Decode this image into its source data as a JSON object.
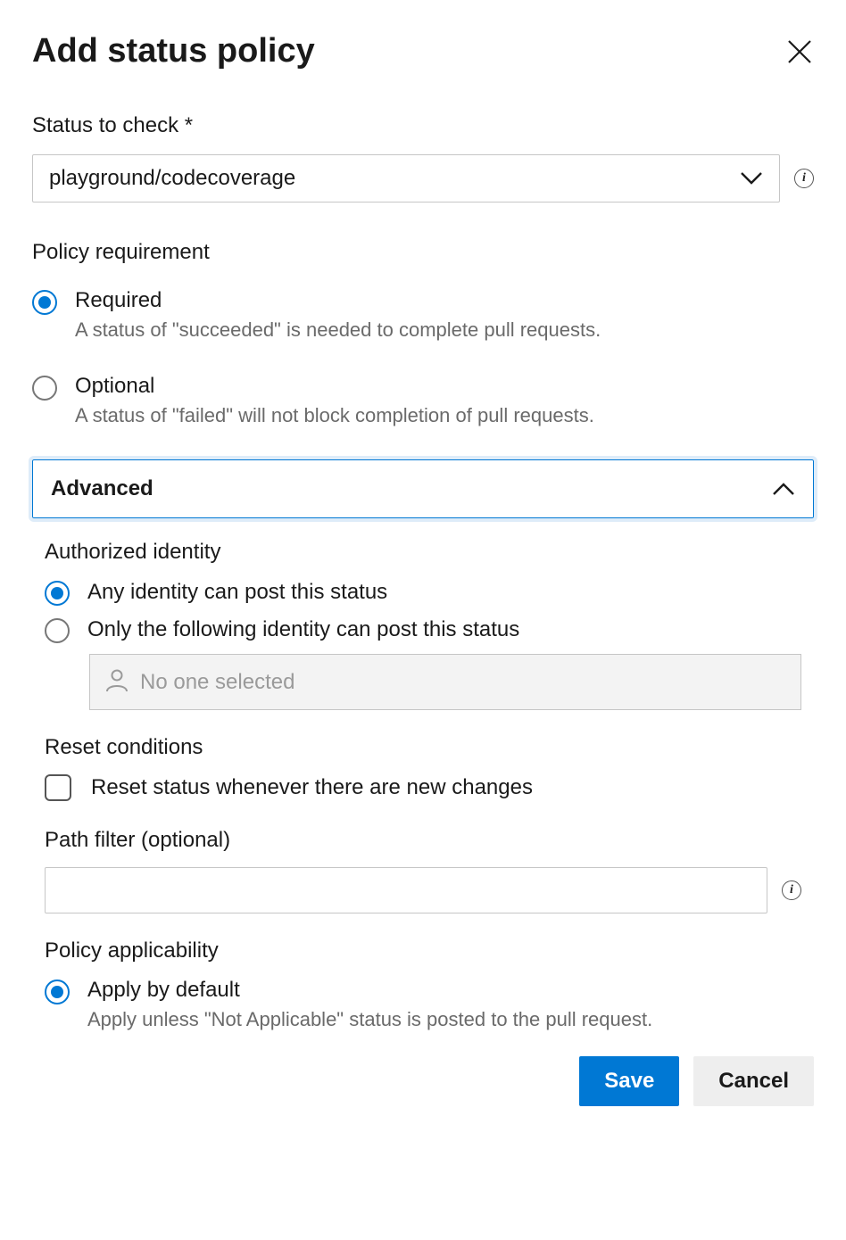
{
  "header": {
    "title": "Add status policy"
  },
  "status_check": {
    "label": "Status to check *",
    "value": "playground/codecoverage"
  },
  "policy_req": {
    "label": "Policy requirement",
    "options": [
      {
        "title": "Required",
        "desc": "A status of \"succeeded\" is needed to complete pull requests.",
        "selected": true
      },
      {
        "title": "Optional",
        "desc": "A status of \"failed\" will not block completion of pull requests.",
        "selected": false
      }
    ]
  },
  "advanced": {
    "title": "Advanced",
    "authorized_identity": {
      "label": "Authorized identity",
      "options": [
        {
          "title": "Any identity can post this status",
          "selected": true
        },
        {
          "title": "Only the following identity can post this status",
          "selected": false
        }
      ],
      "placeholder": "No one selected"
    },
    "reset": {
      "label": "Reset conditions",
      "checkbox_label": "Reset status whenever there are new changes",
      "checked": false
    },
    "path_filter": {
      "label": "Path filter (optional)",
      "value": ""
    },
    "applicability": {
      "label": "Policy applicability",
      "options": [
        {
          "title": "Apply by default",
          "desc": "Apply unless \"Not Applicable\" status is posted to the pull request.",
          "selected": true
        }
      ]
    }
  },
  "buttons": {
    "save": "Save",
    "cancel": "Cancel"
  }
}
